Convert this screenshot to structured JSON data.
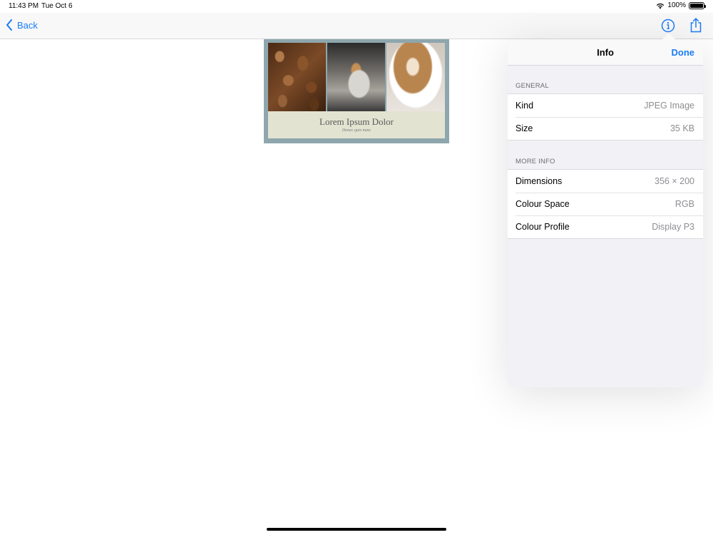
{
  "status_bar": {
    "time": "11:43 PM",
    "date": "Tue Oct 6",
    "battery": "100%"
  },
  "nav": {
    "back_label": "Back",
    "info_icon": "info-circle-icon",
    "share_icon": "share-icon",
    "accent": "#1a7cf5"
  },
  "preview": {
    "title": "Lorem Ipsum Dolor",
    "subtitle": "Donec quis nunc"
  },
  "info": {
    "title": "Info",
    "done_label": "Done",
    "sections": [
      {
        "header": "GENERAL",
        "rows": [
          {
            "key": "Kind",
            "value": "JPEG Image"
          },
          {
            "key": "Size",
            "value": "35 KB"
          }
        ]
      },
      {
        "header": "MORE INFO",
        "rows": [
          {
            "key": "Dimensions",
            "value": "356 × 200"
          },
          {
            "key": "Colour Space",
            "value": "RGB"
          },
          {
            "key": "Colour Profile",
            "value": "Display P3"
          }
        ]
      }
    ]
  }
}
